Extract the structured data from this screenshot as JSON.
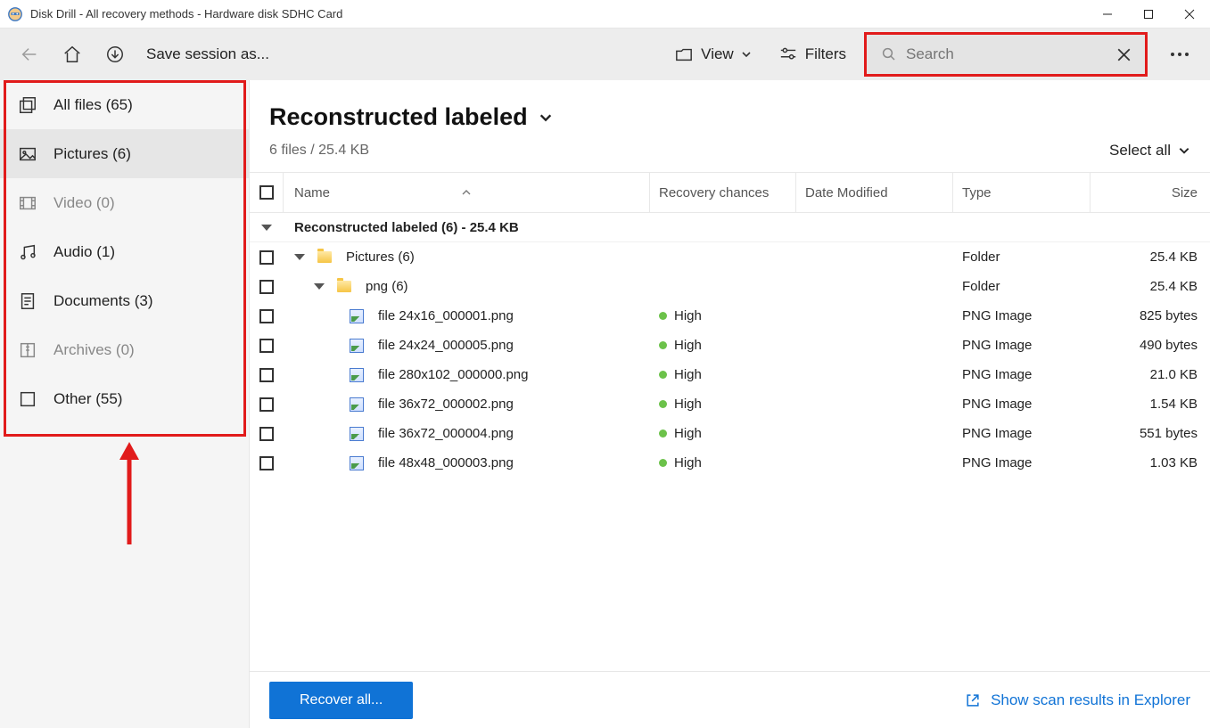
{
  "window": {
    "title": "Disk Drill - All recovery methods - Hardware disk SDHC Card"
  },
  "toolbar": {
    "save_session": "Save session as...",
    "view": "View",
    "filters": "Filters",
    "search_placeholder": "Search"
  },
  "sidebar": {
    "items": [
      {
        "label": "All files (65)",
        "dim": false
      },
      {
        "label": "Pictures (6)",
        "dim": false,
        "active": true
      },
      {
        "label": "Video (0)",
        "dim": true
      },
      {
        "label": "Audio (1)",
        "dim": false
      },
      {
        "label": "Documents (3)",
        "dim": false
      },
      {
        "label": "Archives (0)",
        "dim": true
      },
      {
        "label": "Other (55)",
        "dim": false
      }
    ]
  },
  "main": {
    "title": "Reconstructed labeled",
    "subtitle": "6 files / 25.4 KB",
    "select_all": "Select all",
    "columns": {
      "name": "Name",
      "recovery": "Recovery chances",
      "date": "Date Modified",
      "type": "Type",
      "size": "Size"
    },
    "group_label": "Reconstructed labeled (6) - 25.4 KB",
    "rows": [
      {
        "indent": 1,
        "kind": "folder",
        "name": "Pictures (6)",
        "type": "Folder",
        "size": "25.4 KB"
      },
      {
        "indent": 2,
        "kind": "folder",
        "name": "png (6)",
        "type": "Folder",
        "size": "25.4 KB"
      },
      {
        "indent": 3,
        "kind": "file",
        "name": "file 24x16_000001.png",
        "recovery": "High",
        "type": "PNG Image",
        "size": "825 bytes"
      },
      {
        "indent": 3,
        "kind": "file",
        "name": "file 24x24_000005.png",
        "recovery": "High",
        "type": "PNG Image",
        "size": "490 bytes"
      },
      {
        "indent": 3,
        "kind": "file",
        "name": "file 280x102_000000.png",
        "recovery": "High",
        "type": "PNG Image",
        "size": "21.0 KB"
      },
      {
        "indent": 3,
        "kind": "file",
        "name": "file 36x72_000002.png",
        "recovery": "High",
        "type": "PNG Image",
        "size": "1.54 KB"
      },
      {
        "indent": 3,
        "kind": "file",
        "name": "file 36x72_000004.png",
        "recovery": "High",
        "type": "PNG Image",
        "size": "551 bytes"
      },
      {
        "indent": 3,
        "kind": "file",
        "name": "file 48x48_000003.png",
        "recovery": "High",
        "type": "PNG Image",
        "size": "1.03 KB"
      }
    ]
  },
  "footer": {
    "recover": "Recover all...",
    "explorer": "Show scan results in Explorer"
  }
}
